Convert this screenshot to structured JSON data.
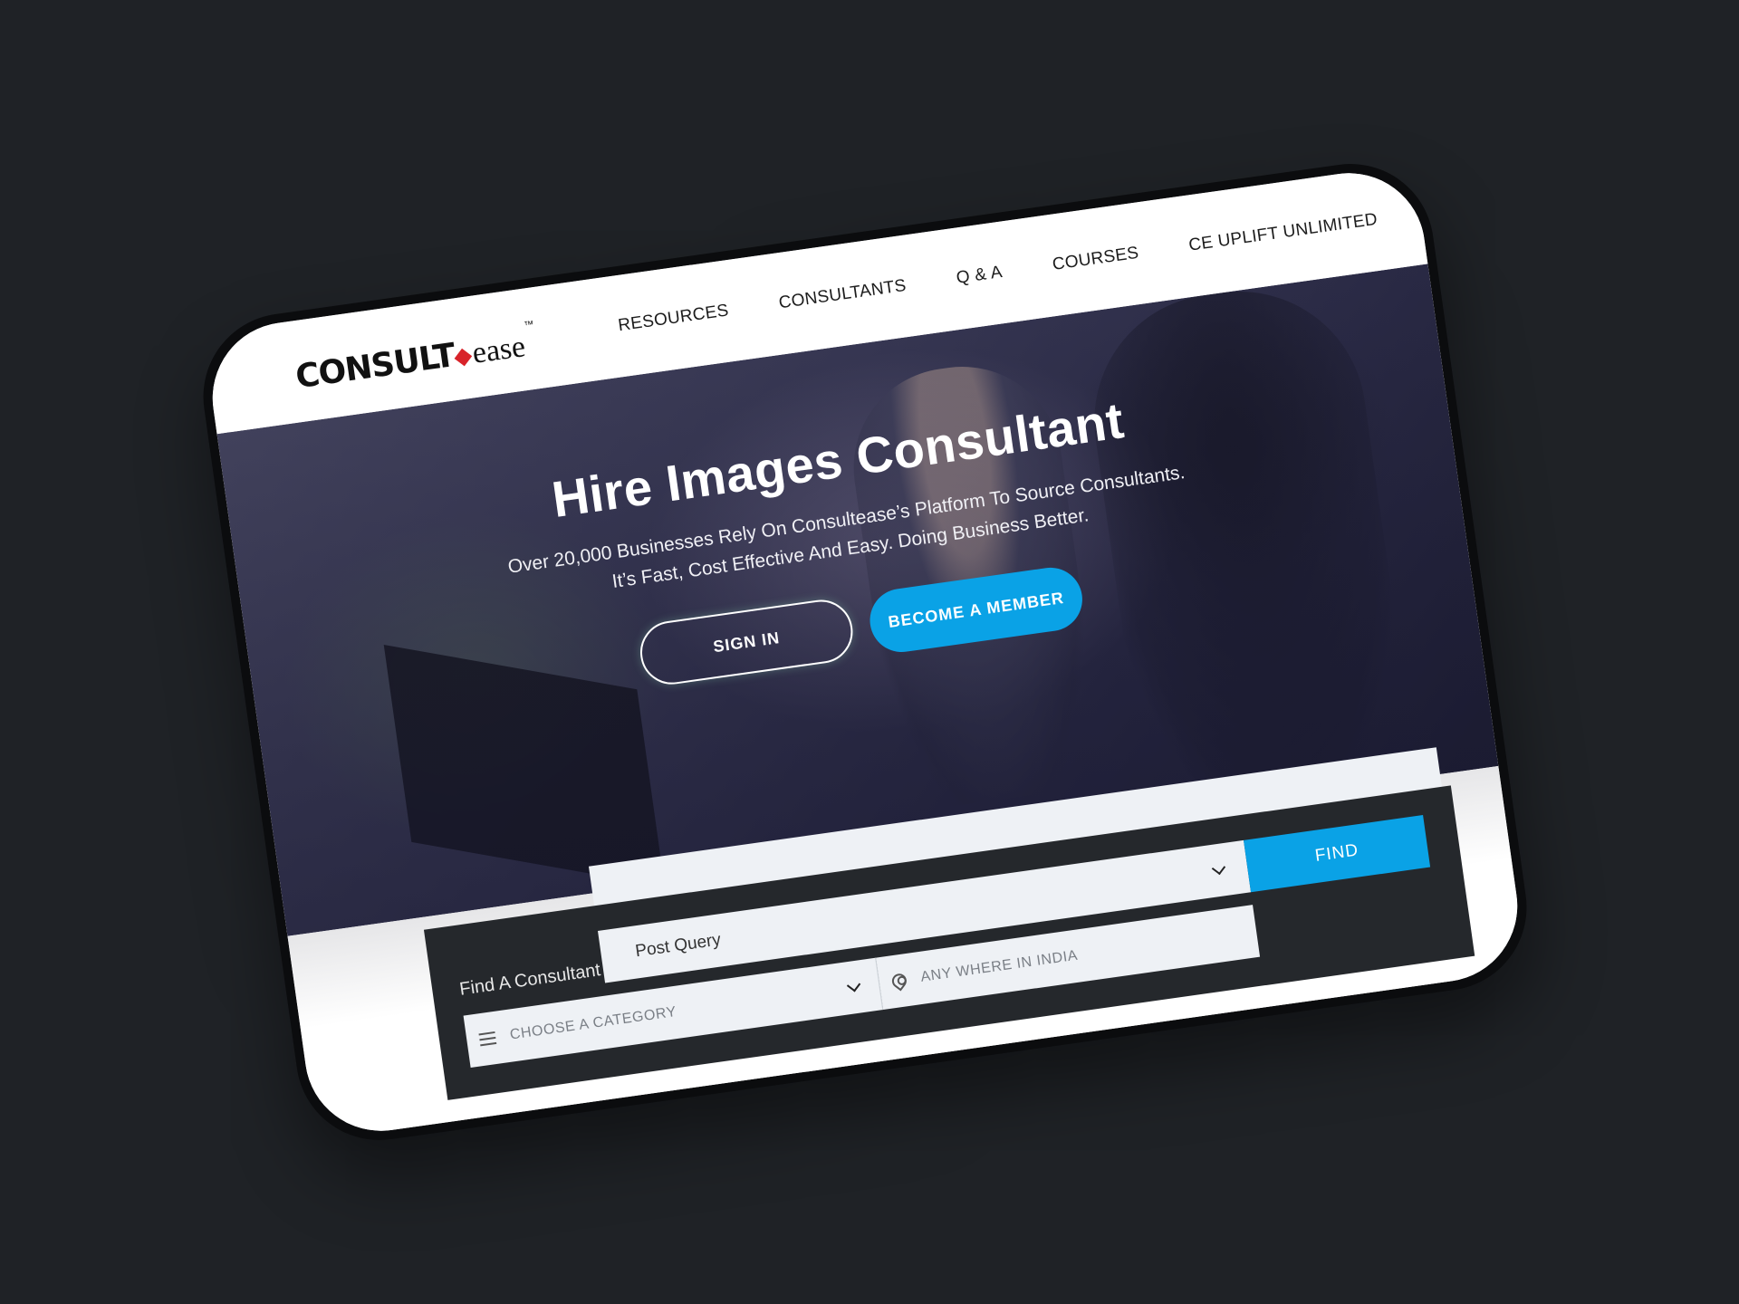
{
  "header": {
    "logo": {
      "part1": "CONSULT",
      "part2": "ease",
      "tm": "™"
    },
    "nav": [
      {
        "label": "RESOURCES"
      },
      {
        "label": "CONSULTANTS"
      },
      {
        "label": "Q & A"
      },
      {
        "label": "COURSES"
      },
      {
        "label": "CE UPLIFT UNLIMITED"
      }
    ],
    "menu_icon": "list-menu-icon"
  },
  "hero": {
    "title": "Hire Images Consultant",
    "subtitle": "Over 20,000 Businesses Rely On Consultease’s Platform  To Source Consultants. It’s Fast, Cost Effective And Easy. Doing Business Better.",
    "sign_in": "SIGN IN",
    "become_member": "BECOME A MEMBER"
  },
  "search": {
    "label": "Find A Consultant",
    "query_selected": "Post Query",
    "find_button": "FIND",
    "category_placeholder": "CHOOSE A CATEGORY",
    "location_placeholder": "ANY WHERE IN INDIA"
  },
  "colors": {
    "accent": "#0aa2e6",
    "brand_red": "#d8232a",
    "background": "#1f2226",
    "panel": "#25282c"
  }
}
